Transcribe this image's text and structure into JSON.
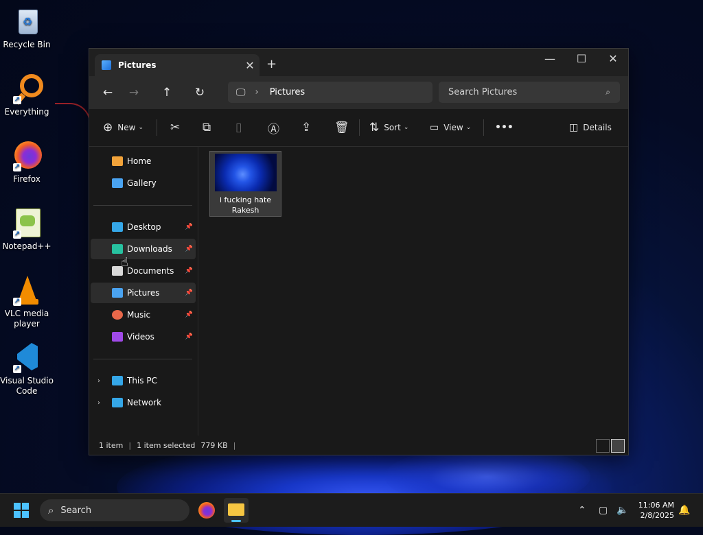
{
  "desktop": {
    "icons": [
      {
        "label": "Recycle Bin"
      },
      {
        "label": "Everything"
      },
      {
        "label": "Firefox"
      },
      {
        "label": "Notepad++"
      },
      {
        "label": "VLC media player"
      },
      {
        "label": "Visual Studio Code"
      }
    ]
  },
  "window": {
    "tab_title": "Pictures",
    "new_tab": "+",
    "address": {
      "path": "Pictures"
    },
    "search": {
      "placeholder": "Search Pictures"
    },
    "toolbar": {
      "new_label": "New",
      "sort_label": "Sort",
      "view_label": "View",
      "more_label": "•••",
      "details_label": "Details"
    },
    "sidebar": {
      "top": [
        {
          "label": "Home",
          "color": "#f2a33a"
        },
        {
          "label": "Gallery",
          "color": "#4aa3f0"
        }
      ],
      "pinned": [
        {
          "label": "Desktop",
          "color": "#35a7e8"
        },
        {
          "label": "Downloads",
          "color": "#27c2a0"
        },
        {
          "label": "Documents",
          "color": "#d9d9d9"
        },
        {
          "label": "Pictures",
          "color": "#4aa3f0"
        },
        {
          "label": "Music",
          "color": "#e8684a"
        },
        {
          "label": "Videos",
          "color": "#a04ae8"
        }
      ],
      "bottom": [
        {
          "label": "This PC",
          "color": "#35a7e8"
        },
        {
          "label": "Network",
          "color": "#35a7e8"
        }
      ]
    },
    "files": [
      {
        "name": "i fucking hate Rakesh"
      }
    ],
    "status": {
      "count": "1 item",
      "selected": "1 item selected",
      "size": "779 KB"
    }
  },
  "taskbar": {
    "search_label": "Search",
    "time": "11:06 AM",
    "date": "2/8/2025"
  }
}
